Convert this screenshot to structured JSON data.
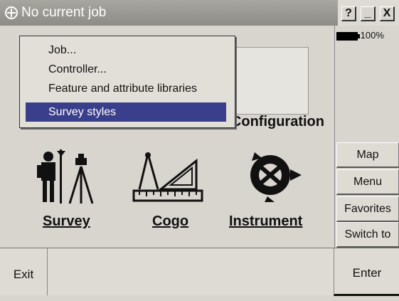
{
  "titlebar": {
    "title": "No current job"
  },
  "window_buttons": {
    "help": "?",
    "minimize": "_",
    "close": "X"
  },
  "status": {
    "battery": "100%"
  },
  "menu": {
    "items": [
      {
        "label": "Job...",
        "selected": false
      },
      {
        "label": "Controller...",
        "selected": false
      },
      {
        "label": "Feature and attribute libraries",
        "selected": false
      },
      {
        "label": "Survey styles",
        "selected": true
      }
    ]
  },
  "apps": {
    "configuration": "Configuration",
    "survey": "Survey",
    "cogo": "Cogo",
    "instrument": "Instrument"
  },
  "side_buttons": {
    "map": "Map",
    "menu": "Menu",
    "favorites": "Favorites",
    "switch_to": "Switch to"
  },
  "bottom": {
    "exit": "Exit",
    "enter": "Enter"
  },
  "colors": {
    "menu_highlight": "#3a3f8c",
    "titlebar": "#9a9892"
  }
}
